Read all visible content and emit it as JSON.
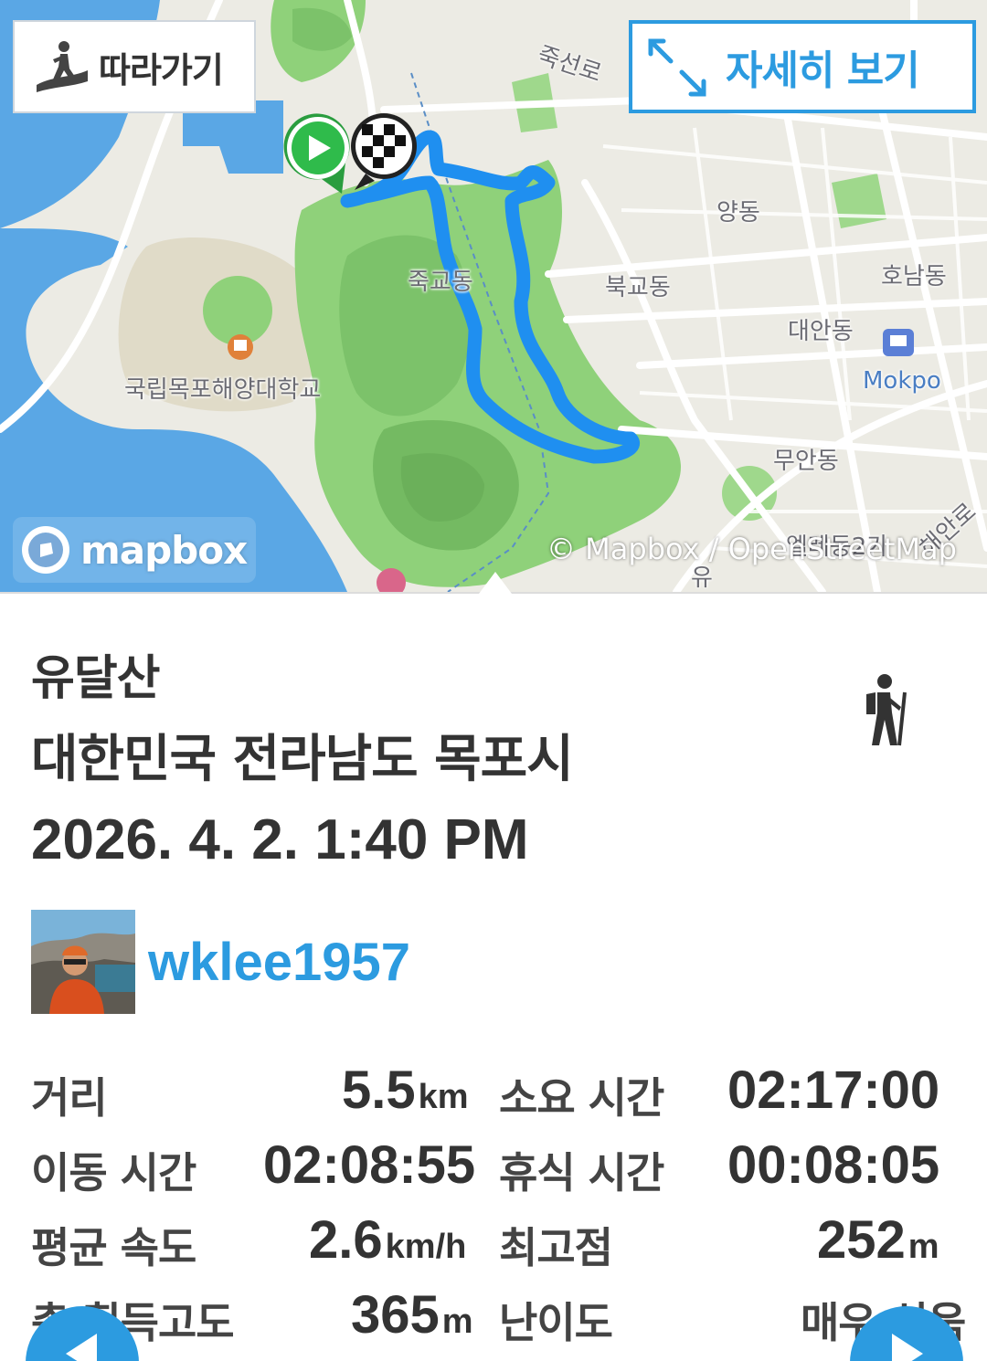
{
  "map": {
    "follow_label": "따라가기",
    "detail_label": "자세히 보기",
    "mapbox_label": "mapbox",
    "attribution": "© Mapbox / OpenStreetMap",
    "labels": {
      "jukseon_ro": "죽선로",
      "yang_dong": "양동",
      "bukgyo_dong": "북교동",
      "honam_dong": "호남동",
      "daean_dong": "대안동",
      "mokpo": "Mokpo",
      "juk_dong": "죽교동",
      "university": "국립목포해양대학교",
      "muan_dong": "무안동",
      "yeonhwa": "엘레동2가",
      "haean_ro": "해안로",
      "yu": "유"
    }
  },
  "track": {
    "name": "유달산",
    "location": "대한민국 전라남도 목포시",
    "datetime": "2026. 4. 2. 1:40 PM",
    "activity_icon": "hiking-icon"
  },
  "user": {
    "username": "wklee1957"
  },
  "stats": {
    "distance_label": "거리",
    "distance_value": "5.5",
    "distance_unit": "km",
    "duration_label": "소요 시간",
    "duration_value": "02:17:00",
    "moving_label": "이동 시간",
    "moving_value": "02:08:55",
    "rest_label": "휴식 시간",
    "rest_value": "00:08:05",
    "avg_speed_label": "평균 속도",
    "avg_speed_value": "2.6",
    "avg_speed_unit": "km/h",
    "max_alt_label": "최고점",
    "max_alt_value": "252",
    "max_alt_unit": "m",
    "ascent_label": "총 획득고도",
    "ascent_value": "365",
    "ascent_unit": "m",
    "difficulty_label": "난이도",
    "difficulty_value": "매우 쉬움"
  },
  "colors": {
    "accent": "#2c9be0",
    "route": "#1f8ff0",
    "water": "#5aa7e5",
    "park": "#8fd17a"
  }
}
